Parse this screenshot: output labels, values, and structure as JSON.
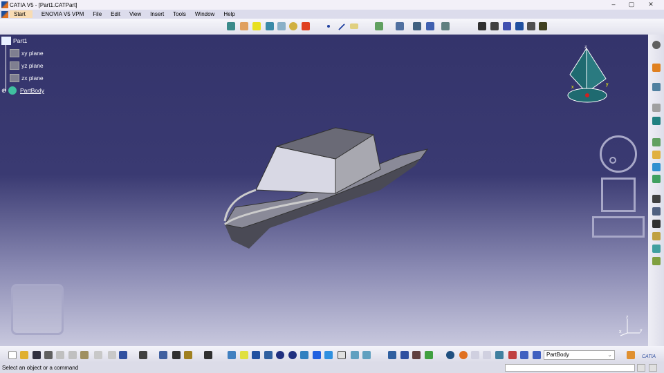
{
  "window": {
    "title": "CATIA V5 - [Part1.CATPart]",
    "controls": [
      "–",
      "▢",
      "✕"
    ]
  },
  "menu": [
    "Start",
    "ENOVIA V5 VPM",
    "File",
    "Edit",
    "View",
    "Insert",
    "Tools",
    "Window",
    "Help"
  ],
  "tree": {
    "root": "Part1",
    "items": [
      "xy plane",
      "yz plane",
      "zx plane"
    ],
    "body": "PartBody"
  },
  "compass": {
    "x": "x",
    "y": "y",
    "z": "z"
  },
  "axis": {
    "x": "x",
    "y": "y",
    "z": "z"
  },
  "bottom": {
    "current_body": "PartBody",
    "brand": "CATIA"
  },
  "status": {
    "message": "Select an object or a command"
  }
}
